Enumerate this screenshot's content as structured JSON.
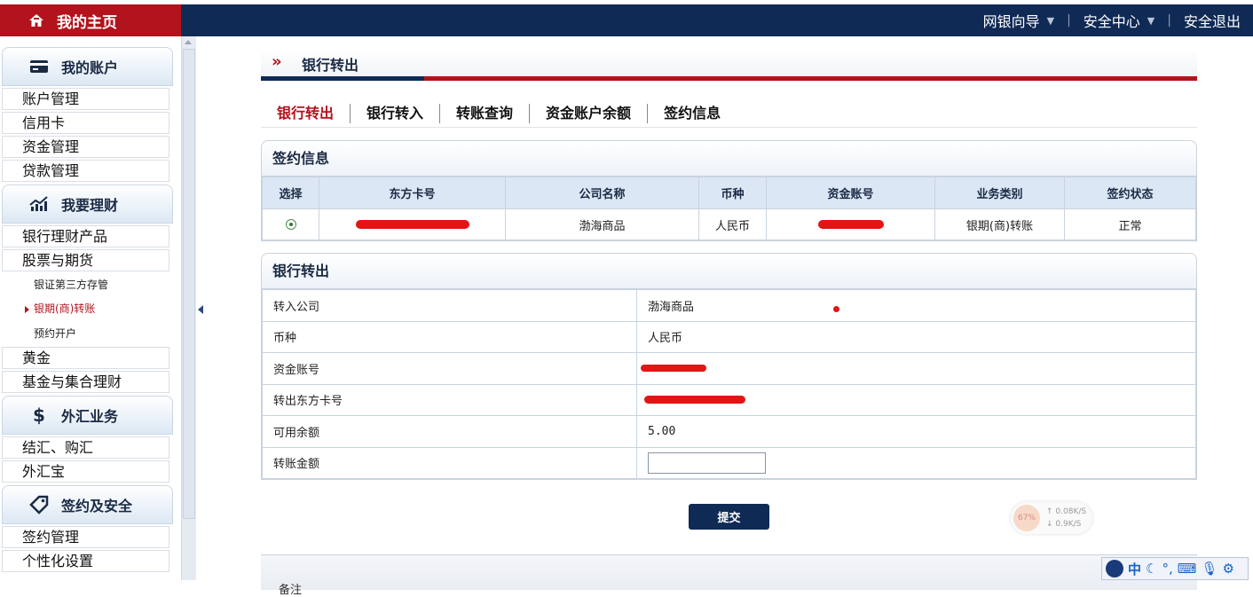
{
  "header": {
    "home_label": "我的主页",
    "links": [
      {
        "label": "网银向导",
        "has_dropdown": true
      },
      {
        "label": "安全中心",
        "has_dropdown": true
      },
      {
        "label": "安全退出",
        "has_dropdown": false
      }
    ]
  },
  "sidebar": {
    "sections": [
      {
        "title": "我的账户",
        "icon": "card-icon",
        "items": [
          "账户管理",
          "信用卡",
          "资金管理",
          "贷款管理"
        ]
      },
      {
        "title": "我要理财",
        "icon": "chart-icon",
        "items": [
          "银行理财产品",
          "股票与期货"
        ],
        "subitems": [
          "银证第三方存管",
          "银期(商)转账",
          "预约开户"
        ],
        "active_subitem": "银期(商)转账",
        "items_after": [
          "黄金",
          "基金与集合理财"
        ]
      },
      {
        "title": "外汇业务",
        "icon": "dollar-icon",
        "items": [
          "结汇、购汇",
          "外汇宝"
        ]
      },
      {
        "title": "签约及安全",
        "icon": "tag-icon",
        "items": [
          "签约管理",
          "个性化设置"
        ]
      }
    ]
  },
  "page": {
    "title": "银行转出",
    "tabs": [
      "银行转出",
      "银行转入",
      "转账查询",
      "资金账户余额",
      "签约信息"
    ],
    "active_tab": "银行转出"
  },
  "sign_info": {
    "title": "签约信息",
    "columns": [
      "选择",
      "东方卡号",
      "公司名称",
      "币种",
      "资金账号",
      "业务类别",
      "签约状态"
    ],
    "row": {
      "company": "渤海商品",
      "currency": "人民币",
      "business_type": "银期(商)转账",
      "status": "正常"
    }
  },
  "transfer_form": {
    "title": "银行转出",
    "fields": [
      {
        "label": "转入公司",
        "value": "渤海商品"
      },
      {
        "label": "币种",
        "value": "人民币"
      },
      {
        "label": "资金账号",
        "value": ""
      },
      {
        "label": "转出东方卡号",
        "value": ""
      },
      {
        "label": "可用余额",
        "value": "5.00"
      },
      {
        "label": "转账金额",
        "value": ""
      }
    ],
    "submit_label": "提交"
  },
  "bottom": {
    "note": "备注"
  },
  "speed_widget": {
    "percent": "67%",
    "up": "0.08K/S",
    "down": "0.9K/S"
  },
  "ime_bar": {
    "mode": "中"
  },
  "colors": {
    "brand_red": "#b3131c",
    "navy": "#0f2a55",
    "redaction": "#e41414"
  }
}
